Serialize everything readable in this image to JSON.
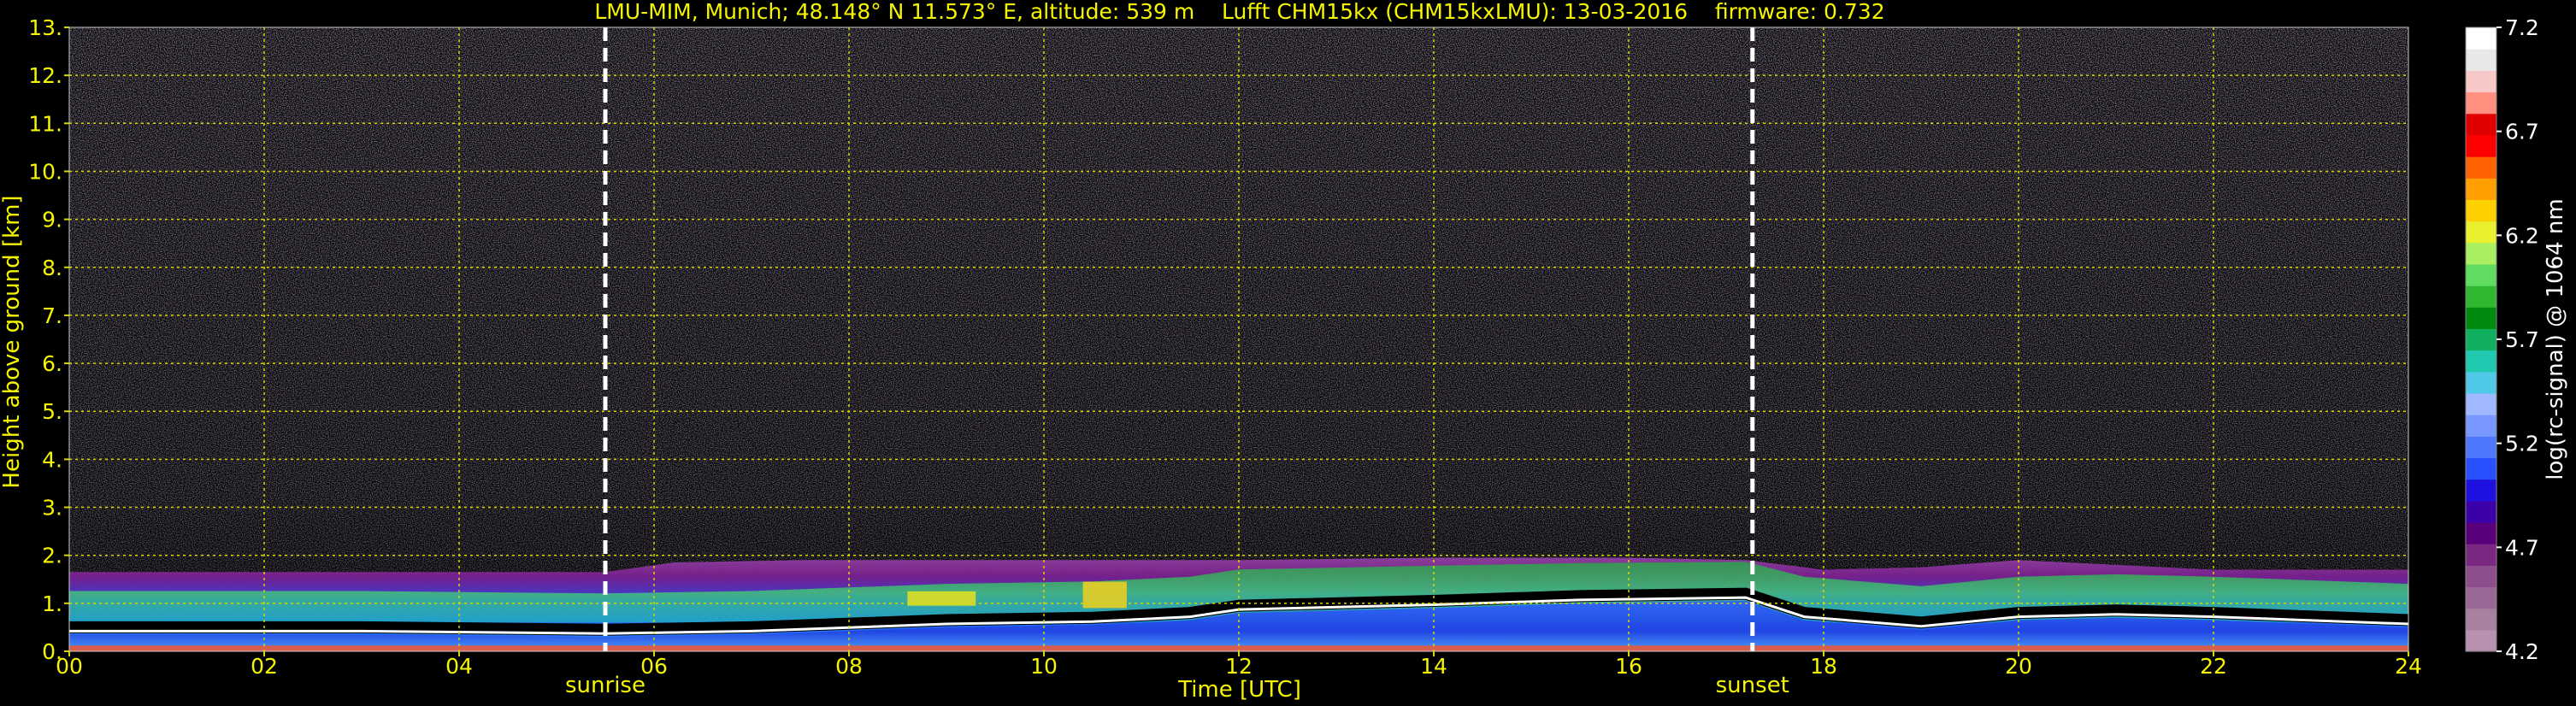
{
  "chart_data": {
    "type": "heatmap",
    "title": "LMU-MIM, Munich; 48.148° N 11.573° E, altitude: 539 m    Lufft CHM15kx (CHM15kxLMU): 13-03-2016    firmware: 0.732",
    "xlabel": "Time [UTC]",
    "ylabel": "Height above ground [km]",
    "xlim": [
      0,
      24
    ],
    "ylim": [
      0,
      13
    ],
    "x_tick_labels": [
      "00",
      "02",
      "04",
      "06",
      "08",
      "10",
      "12",
      "14",
      "16",
      "18",
      "20",
      "22",
      "24"
    ],
    "y_tick_labels": [
      "0.",
      "1.",
      "2.",
      "3.",
      "4.",
      "5.",
      "6.",
      "7.",
      "8.",
      "9.",
      "10.",
      "11.",
      "12.",
      "13."
    ],
    "grid": true,
    "colorbar": {
      "label": "log(rc-signal) @ 1064 nm",
      "range": [
        4.2,
        7.2
      ],
      "tick_labels": [
        "4.2",
        "4.7",
        "5.2",
        "5.7",
        "6.2",
        "6.7",
        "7.2"
      ],
      "colors": [
        "#b890b0",
        "#a880a0",
        "#9a6896",
        "#8c4e8c",
        "#7a2882",
        "#5a007a",
        "#3c00a8",
        "#1e10e0",
        "#2850ff",
        "#5078ff",
        "#7898ff",
        "#a0b8ff",
        "#50c8e8",
        "#20c8b0",
        "#10b060",
        "#008a10",
        "#30b830",
        "#60dc60",
        "#a8f060",
        "#e8f030",
        "#ffd000",
        "#ffa000",
        "#ff6000",
        "#ff0000",
        "#e00000",
        "#ff9080",
        "#f8c8c8",
        "#e8e8e8",
        "#ffffff"
      ]
    },
    "annotations": [
      {
        "x": 5.5,
        "label": "sunrise"
      },
      {
        "x": 17.27,
        "label": "sunset"
      }
    ],
    "layers": {
      "bottom_band_top_km": [
        [
          0,
          0.5
        ],
        [
          3,
          0.5
        ],
        [
          5.5,
          0.45
        ],
        [
          7,
          0.5
        ],
        [
          9,
          0.65
        ],
        [
          10.5,
          0.7
        ],
        [
          11.5,
          0.8
        ],
        [
          12,
          0.95
        ],
        [
          14,
          1.05
        ],
        [
          15.5,
          1.15
        ],
        [
          17.2,
          1.2
        ],
        [
          17.8,
          0.8
        ],
        [
          19,
          0.6
        ],
        [
          20,
          0.8
        ],
        [
          21,
          0.85
        ],
        [
          22,
          0.8
        ],
        [
          24,
          0.65
        ]
      ],
      "aerosol_top_km": [
        [
          0,
          1.65
        ],
        [
          5.5,
          1.65
        ],
        [
          6.2,
          1.85
        ],
        [
          7.5,
          1.9
        ],
        [
          9,
          1.9
        ],
        [
          10.5,
          1.9
        ],
        [
          12,
          1.9
        ],
        [
          14,
          1.95
        ],
        [
          16,
          1.95
        ],
        [
          17.2,
          1.9
        ],
        [
          18,
          1.7
        ],
        [
          19,
          1.75
        ],
        [
          20,
          1.9
        ],
        [
          21,
          1.8
        ],
        [
          22,
          1.7
        ],
        [
          24,
          1.7
        ]
      ]
    }
  }
}
